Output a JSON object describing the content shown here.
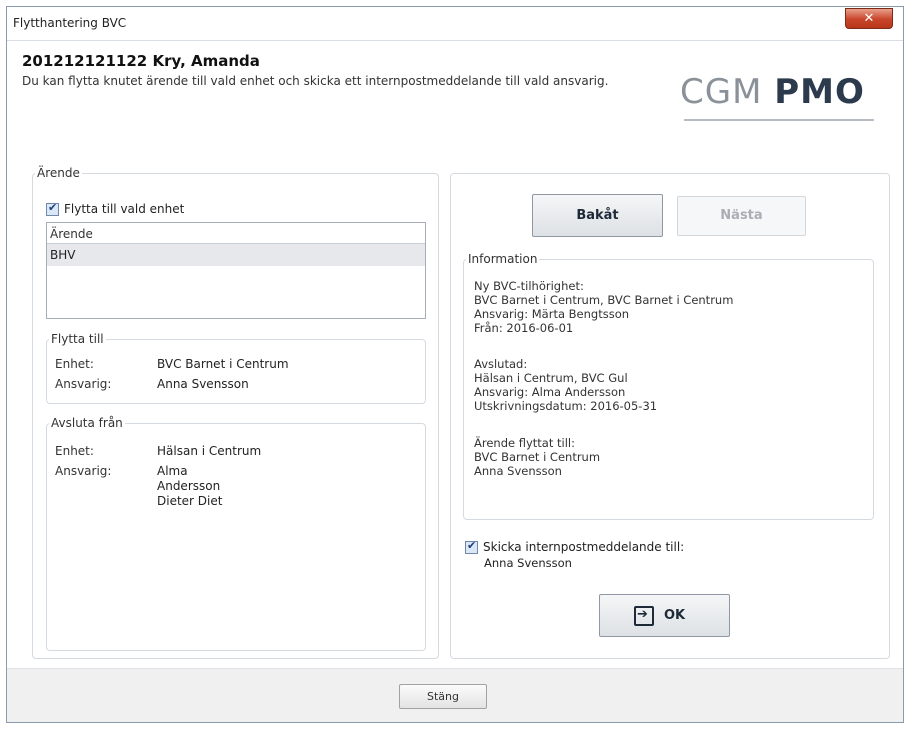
{
  "window": {
    "title": "Flytthantering BVC",
    "close_glyph": "✕"
  },
  "header": {
    "patient": "201212121122 Kry, Amanda",
    "description": "Du kan flytta knutet ärende till vald enhet och skicka ett internpostmeddelande till vald ansvarig."
  },
  "logo": {
    "part1": "CGM ",
    "part2": "PMO"
  },
  "arende": {
    "legend": "Ärende",
    "move_checkbox_label": "Flytta till vald enhet",
    "move_checked": true,
    "list_header": "Ärende",
    "list_rows": [
      "BHV"
    ]
  },
  "flytta_till": {
    "legend": "Flytta till",
    "unit_label": "Enhet:",
    "unit_value": "BVC Barnet i Centrum",
    "resp_label": "Ansvarig:",
    "resp_value": "Anna Svensson"
  },
  "avsluta_fran": {
    "legend": "Avsluta från",
    "unit_label": "Enhet:",
    "unit_value": "Hälsan i Centrum",
    "resp_label": "Ansvarig:",
    "resp_lines": [
      "Alma",
      "Andersson",
      "Dieter Diet"
    ]
  },
  "nav": {
    "back_label": "Bakåt",
    "next_label": "Nästa"
  },
  "information": {
    "legend": "Information",
    "block1": [
      "Ny BVC-tilhörighet:",
      "BVC Barnet i Centrum, BVC Barnet i Centrum",
      "Ansvarig: Märta Bengtsson",
      "Från:  2016-06-01"
    ],
    "block2": [
      "Avslutad:",
      "Hälsan i Centrum, BVC Gul",
      "Ansvarig: Alma Andersson",
      "Utskrivningsdatum: 2016-05-31"
    ],
    "block3": [
      "Ärende flyttat till:",
      "BVC Barnet i Centrum",
      "Anna Svensson"
    ]
  },
  "internpost": {
    "checkbox_label": "Skicka internpostmeddelande till:",
    "checked": true,
    "recipient": "Anna Svensson"
  },
  "ok": {
    "label": "OK"
  },
  "footer": {
    "close_label": "Stäng"
  }
}
